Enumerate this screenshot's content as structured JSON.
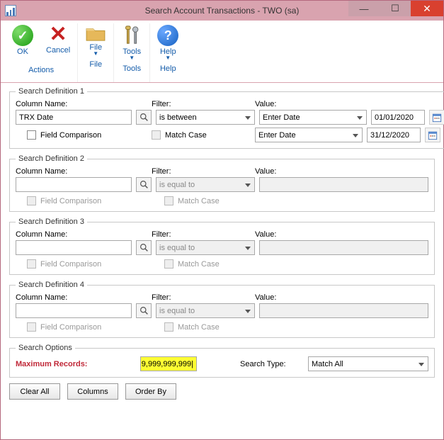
{
  "window": {
    "title": "Search Account Transactions  -  TWO (sa)"
  },
  "toolbar": {
    "ok": "OK",
    "cancel": "Cancel",
    "file": "File",
    "tools": "Tools",
    "help": "Help",
    "groups": {
      "actions": "Actions",
      "file": "File",
      "tools": "Tools",
      "help": "Help"
    }
  },
  "labels": {
    "column_name": "Column Name:",
    "filter": "Filter:",
    "value": "Value:",
    "field_comparison": "Field Comparison",
    "match_case": "Match Case"
  },
  "defs": [
    {
      "legend": "Search Definition 1",
      "column": "TRX Date",
      "filter": "is between",
      "value_type": "dateselect",
      "value_sel1": "Enter Date",
      "value_sel2": "Enter Date",
      "date1": "01/01/2020",
      "date2": "31/12/2020",
      "fc_enabled": true,
      "mc_enabled": false
    },
    {
      "legend": "Search Definition 2",
      "column": "",
      "filter": "is equal to",
      "value_type": "text",
      "value_text": "",
      "fc_enabled": false,
      "mc_enabled": false
    },
    {
      "legend": "Search Definition 3",
      "column": "",
      "filter": "is equal to",
      "value_type": "text",
      "value_text": "",
      "fc_enabled": false,
      "mc_enabled": false
    },
    {
      "legend": "Search Definition 4",
      "column": "",
      "filter": "is equal to",
      "value_type": "text",
      "value_text": "",
      "fc_enabled": false,
      "mc_enabled": false
    }
  ],
  "search_options": {
    "legend": "Search Options",
    "max_records_label": "Maximum Records:",
    "max_records_value": "9,999,999,999",
    "search_type_label": "Search Type:",
    "search_type_value": "Match All"
  },
  "buttons": {
    "clear_all": "Clear All",
    "columns": "Columns",
    "order_by": "Order By"
  }
}
